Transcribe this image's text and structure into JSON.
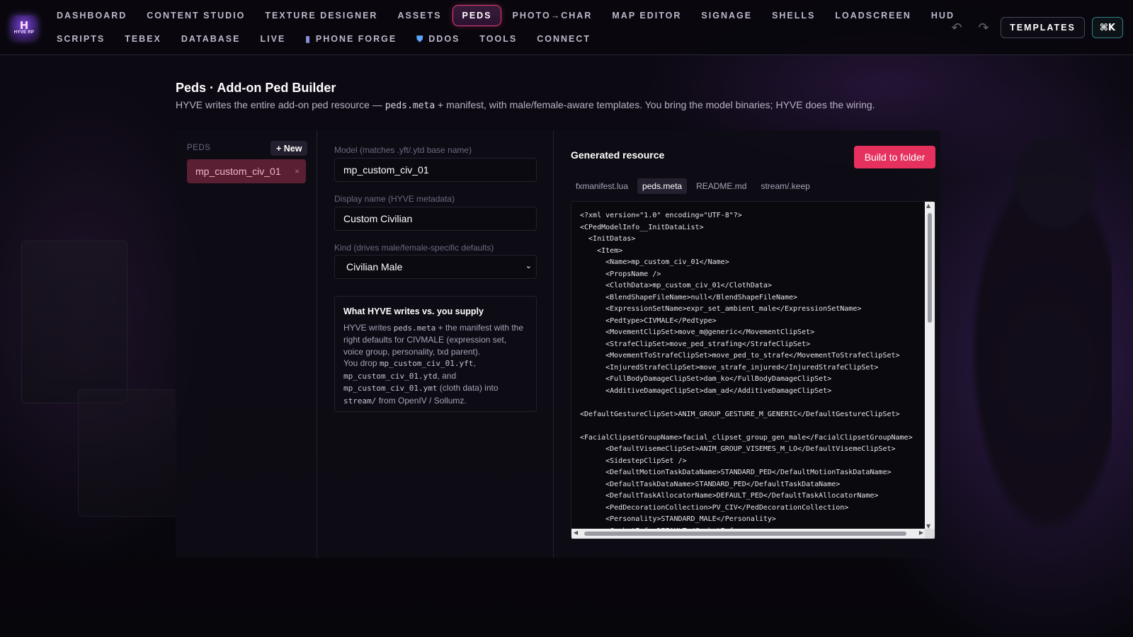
{
  "logo": {
    "mark": "H",
    "text": "HYVE RP"
  },
  "nav": {
    "row1": [
      {
        "label": "DASHBOARD"
      },
      {
        "label": "CONTENT STUDIO"
      },
      {
        "label": "TEXTURE DESIGNER"
      },
      {
        "label": "ASSETS"
      },
      {
        "label": "PEDS",
        "active": true
      },
      {
        "label": "PHOTO→CHAR"
      },
      {
        "label": "MAP EDITOR"
      },
      {
        "label": "SIGNAGE"
      },
      {
        "label": "SHELLS"
      },
      {
        "label": "LOADSCREEN"
      },
      {
        "label": "HUD"
      }
    ],
    "row2": [
      {
        "label": "SCRIPTS"
      },
      {
        "label": "TEBEX"
      },
      {
        "label": "DATABASE"
      },
      {
        "label": "LIVE"
      },
      {
        "label": "PHONE FORGE",
        "icon": "phone-icon",
        "glyph": "▮"
      },
      {
        "label": "DDOS",
        "icon": "shield-icon",
        "glyph": "⛊"
      },
      {
        "label": "TOOLS"
      },
      {
        "label": "CONNECT"
      }
    ]
  },
  "toolbar": {
    "undo_glyph": "↶",
    "redo_glyph": "↷",
    "templates_label": "TEMPLATES",
    "command_label": "⌘K"
  },
  "header": {
    "title": "Peds · Add-on Ped Builder",
    "subtitle_pre": "HYVE writes the entire add-on ped resource — ",
    "subtitle_code": "peds.meta",
    "subtitle_post": " + manifest, with male/female-aware templates. You bring the model binaries; HYVE does the wiring."
  },
  "peds": {
    "label": "PEDS",
    "new_label": "+ New",
    "items": [
      {
        "name": "mp_custom_civ_01",
        "remove": "×"
      }
    ]
  },
  "form": {
    "model_label": "Model (matches .yft/.ytd base name)",
    "model_value": "mp_custom_civ_01",
    "display_label": "Display name (HYVE metadata)",
    "display_value": "Custom Civilian",
    "kind_label": "Kind (drives male/female-specific defaults)",
    "kind_value": "Civilian Male",
    "kind_chevron": "⌄",
    "info": {
      "title": "What HYVE writes vs. you supply",
      "p1_a": "HYVE writes ",
      "p1_code": "peds.meta",
      "p1_b": " + the manifest with the right defaults for CIVMALE (expression set, voice group, personality, txd parent).",
      "p2_a": "You drop ",
      "p2_code1": "mp_custom_civ_01.yft",
      "p2_b": ", ",
      "p2_code2": "mp_custom_civ_01.ytd",
      "p2_c": ", and ",
      "p2_code3": "mp_custom_civ_01.ymt",
      "p2_d": " (cloth data) into ",
      "p2_code4": "stream/",
      "p2_e": " from OpenIV / Sollumz."
    }
  },
  "output": {
    "title": "Generated resource",
    "build_label": "Build to folder",
    "tabs": [
      {
        "label": "fxmanifest.lua"
      },
      {
        "label": "peds.meta",
        "active": true
      },
      {
        "label": "README.md"
      },
      {
        "label": "stream/.keep"
      }
    ],
    "code_lines": [
      "<?xml version=\"1.0\" encoding=\"UTF-8\"?>",
      "<CPedModelInfo__InitDataList>",
      "  <InitDatas>",
      "    <Item>",
      "      <Name>mp_custom_civ_01</Name>",
      "      <PropsName />",
      "      <ClothData>mp_custom_civ_01</ClothData>",
      "      <BlendShapeFileName>null</BlendShapeFileName>",
      "      <ExpressionSetName>expr_set_ambient_male</ExpressionSetName>",
      "      <Pedtype>CIVMALE</Pedtype>",
      "      <MovementClipSet>move_m@generic</MovementClipSet>",
      "      <StrafeClipSet>move_ped_strafing</StrafeClipSet>",
      "      <MovementToStrafeClipSet>move_ped_to_strafe</MovementToStrafeClipSet>",
      "      <InjuredStrafeClipSet>move_strafe_injured</InjuredStrafeClipSet>",
      "      <FullBodyDamageClipSet>dam_ko</FullBodyDamageClipSet>",
      "      <AdditiveDamageClipSet>dam_ad</AdditiveDamageClipSet>",
      "",
      "<DefaultGestureClipSet>ANIM_GROUP_GESTURE_M_GENERIC</DefaultGestureClipSet>",
      "",
      "<FacialClipsetGroupName>facial_clipset_group_gen_male</FacialClipsetGroupName>",
      "      <DefaultVisemeClipSet>ANIM_GROUP_VISEMES_M_LO</DefaultVisemeClipSet>",
      "      <SidestepClipSet />",
      "      <DefaultMotionTaskDataName>STANDARD_PED</DefaultMotionTaskDataName>",
      "      <DefaultTaskDataName>STANDARD_PED</DefaultTaskDataName>",
      "      <DefaultTaskAllocatorName>DEFAULT_PED</DefaultTaskAllocatorName>",
      "      <PedDecorationCollection>PV_CIV</PedDecorationCollection>",
      "      <Personality>STANDARD_MALE</Personality>",
      "      <CombatInfo>DEFAULT</CombatInfo>"
    ]
  },
  "colors": {
    "accent": "#e6315f",
    "active_border": "#e0407a",
    "selected_item": "#5a1f33"
  }
}
